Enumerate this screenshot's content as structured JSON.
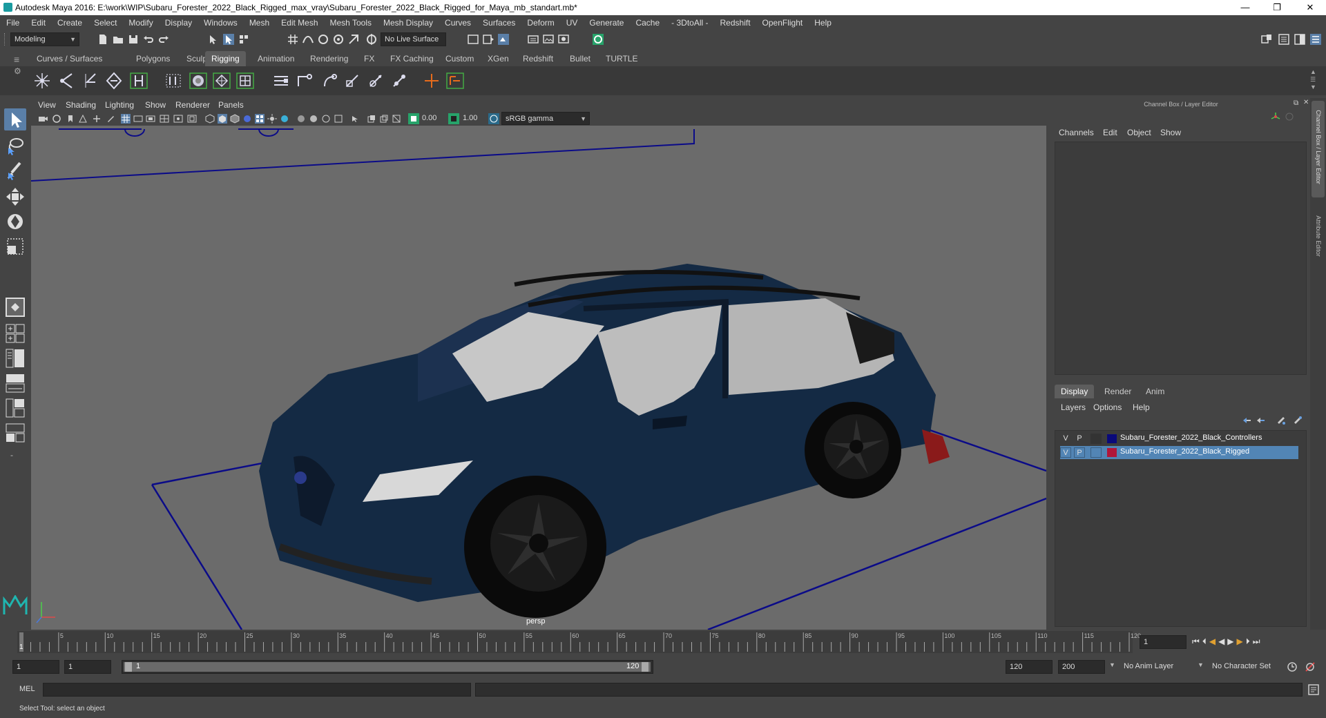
{
  "titlebar": {
    "title": "Autodesk Maya 2016: E:\\work\\WIP\\Subaru_Forester_2022_Black_Rigged_max_vray\\Subaru_Forester_2022_Black_Rigged_for_Maya_mb_standart.mb*",
    "minimize": "—",
    "restore": "❐",
    "close": "✕"
  },
  "menubar": {
    "items": [
      "File",
      "Edit",
      "Create",
      "Select",
      "Modify",
      "Display",
      "Windows",
      "Mesh",
      "Edit Mesh",
      "Mesh Tools",
      "Mesh Display",
      "Curves",
      "Surfaces",
      "Deform",
      "UV",
      "Generate",
      "Cache",
      "- 3DtoAll -",
      "Redshift",
      "OpenFlight",
      "Help"
    ]
  },
  "statusline": {
    "mode": "Modeling",
    "live_surface": "No Live Surface"
  },
  "shelf": {
    "tabs": [
      "Curves / Surfaces",
      "Polygons",
      "Sculpting",
      "Rigging",
      "Animation",
      "Rendering",
      "FX",
      "FX Caching",
      "Custom",
      "XGen",
      "Redshift",
      "Bullet",
      "TURTLE"
    ],
    "active_tab": "Rigging"
  },
  "viewport": {
    "menu": [
      "View",
      "Shading",
      "Lighting",
      "Show",
      "Renderer",
      "Panels"
    ],
    "exposure": "0.00",
    "gamma": "1.00",
    "color_space": "sRGB gamma",
    "camera_label": "persp"
  },
  "channelbox": {
    "title": "Channel Box / Layer Editor",
    "menu": [
      "Channels",
      "Edit",
      "Object",
      "Show"
    ]
  },
  "layereditor": {
    "tabs": [
      "Display",
      "Render",
      "Anim"
    ],
    "active_tab": "Display",
    "menu": [
      "Layers",
      "Options",
      "Help"
    ],
    "layers": [
      {
        "v": "V",
        "p": "P",
        "name": "Subaru_Forester_2022_Black_Controllers",
        "color": "#0a0a7a",
        "selected": false
      },
      {
        "v": "V",
        "p": "P",
        "name": "Subaru_Forester_2022_Black_Rigged",
        "color": "#b0163a",
        "selected": true
      }
    ]
  },
  "sidetabs": [
    "Channel Box / Layer Editor",
    "Attribute Editor"
  ],
  "timeline": {
    "ticks": [
      "5",
      "10",
      "15",
      "20",
      "25",
      "30",
      "35",
      "40",
      "45",
      "50",
      "55",
      "60",
      "65",
      "70",
      "75",
      "80",
      "85",
      "90",
      "95",
      "100",
      "105",
      "110",
      "115",
      "120"
    ],
    "first_tick": "1",
    "current_frame": "1"
  },
  "range": {
    "start": "1",
    "playback_start": "1",
    "slider_start": "1",
    "slider_end": "120",
    "playback_end": "120",
    "end": "200",
    "anim_layer": "No Anim Layer",
    "character_set": "No Character Set"
  },
  "cmdline": {
    "label": "MEL"
  },
  "helpline": {
    "text": "Select Tool: select an object"
  }
}
